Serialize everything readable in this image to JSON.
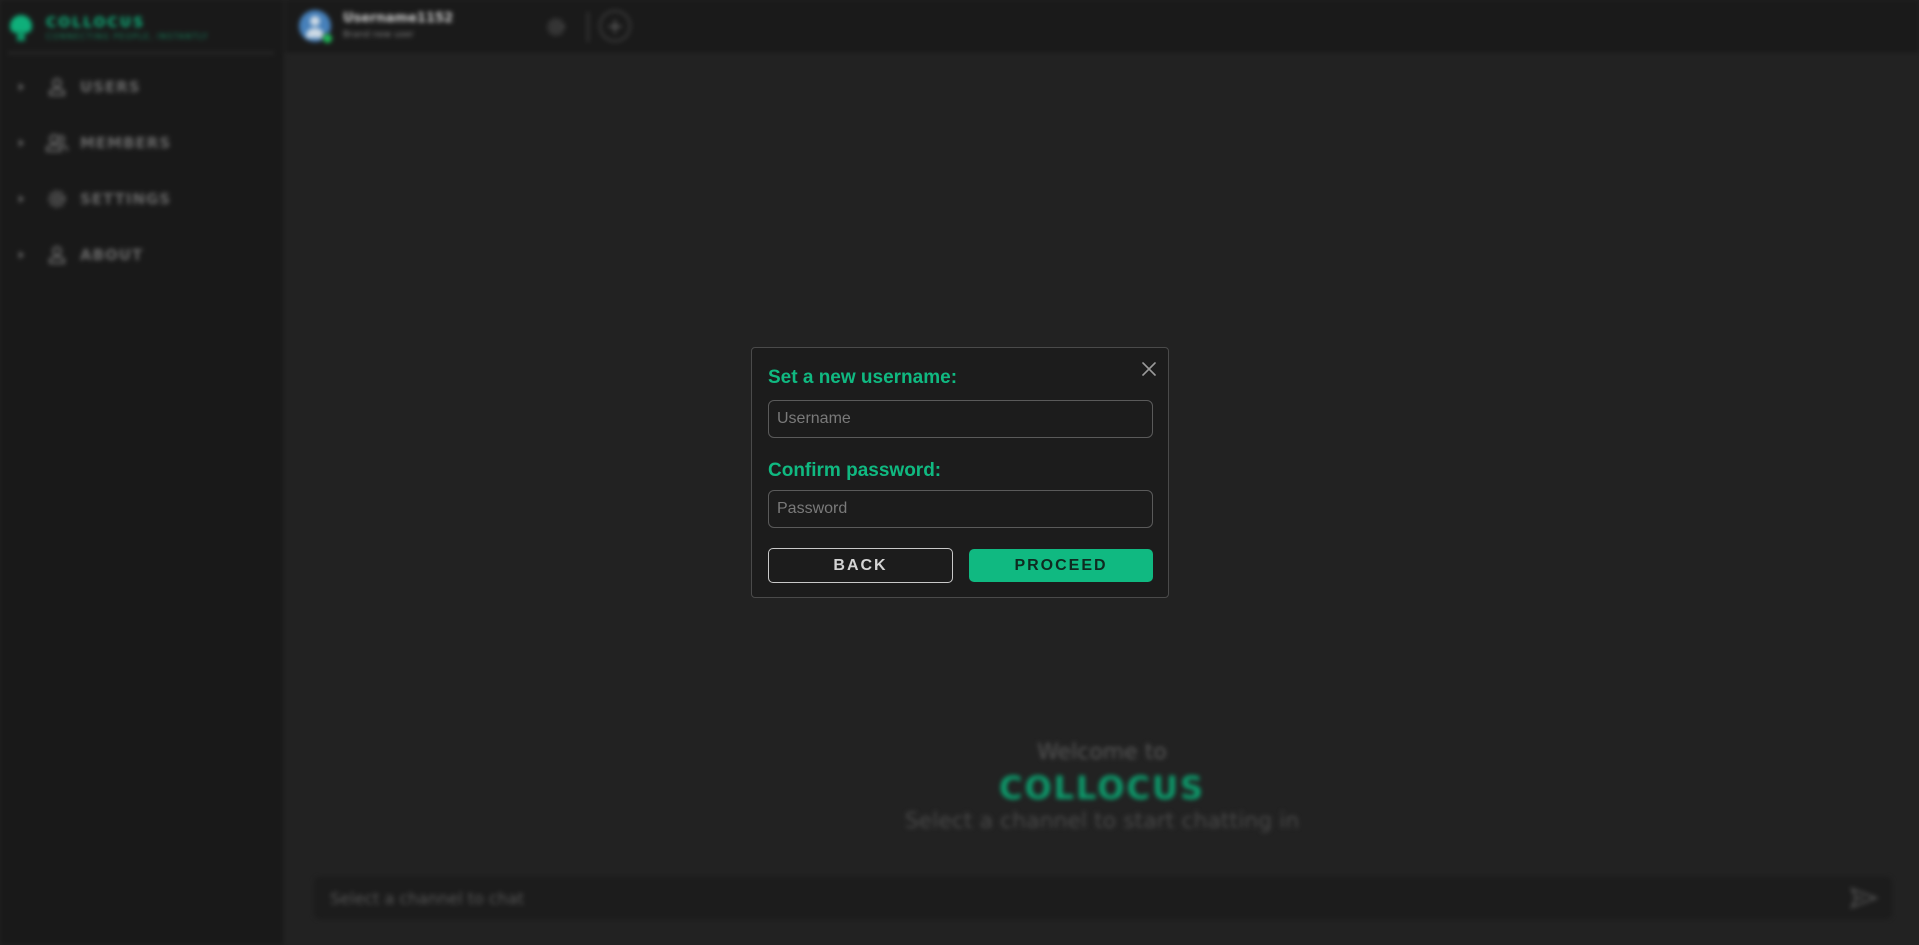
{
  "app": {
    "brand_name": "COLLOCUS",
    "brand_tagline": "CONNECTING PEOPLE, INSTANTLY"
  },
  "sidebar": {
    "items": [
      {
        "label": "USERS",
        "icon": "user-icon"
      },
      {
        "label": "MEMBERS",
        "icon": "members-icon"
      },
      {
        "label": "SETTINGS",
        "icon": "gear-icon"
      },
      {
        "label": "ABOUT",
        "icon": "user-icon"
      }
    ]
  },
  "topbar": {
    "username": "Username1152",
    "status": "Brand new user"
  },
  "welcome": {
    "line1": "Welcome to",
    "brand": "COLLOCUS",
    "line2": "Select a channel to start chatting in"
  },
  "chat": {
    "placeholder": "Select a channel to chat"
  },
  "modal": {
    "username_label": "Set a new username:",
    "username_placeholder": "Username",
    "password_label": "Confirm password:",
    "password_placeholder": "Password",
    "back_label": "BACK",
    "proceed_label": "PROCEED"
  },
  "colors": {
    "accent": "#10b981",
    "background": "#242424",
    "sidebar": "#1b1b1b",
    "modal": "#1c1c1c"
  }
}
